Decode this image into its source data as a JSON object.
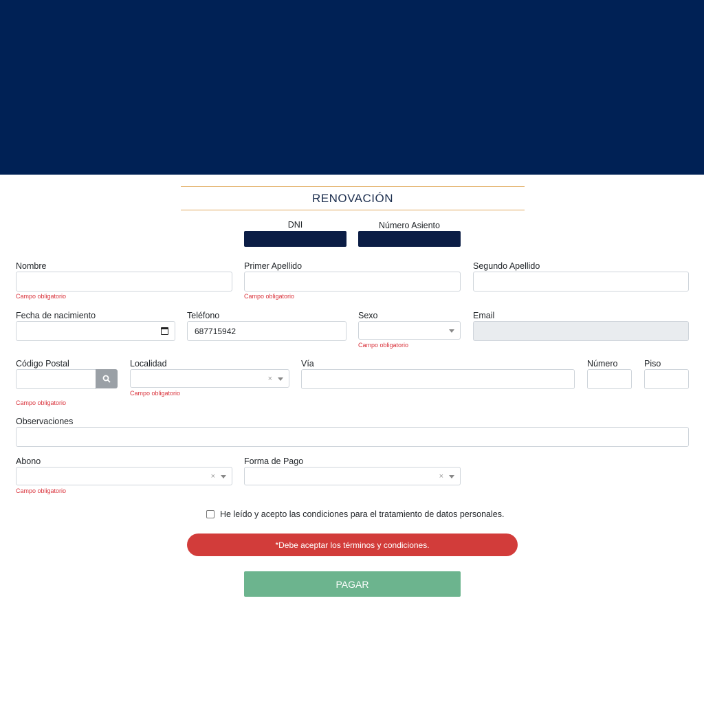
{
  "header": {
    "title": "RENOVACIÓN"
  },
  "ids": {
    "dni_label": "DNI",
    "seat_label": "Número Asiento"
  },
  "form": {
    "nombre": {
      "label": "Nombre",
      "error": "Campo obligatorio",
      "value": ""
    },
    "primer_apellido": {
      "label": "Primer Apellido",
      "error": "Campo obligatorio",
      "value": ""
    },
    "segundo_apellido": {
      "label": "Segundo Apellido",
      "value": ""
    },
    "fecha_nacimiento": {
      "label": "Fecha de nacimiento",
      "value": ""
    },
    "telefono": {
      "label": "Teléfono",
      "value": "687715942"
    },
    "sexo": {
      "label": "Sexo",
      "error": "Campo obligatorio",
      "value": ""
    },
    "email": {
      "label": "Email",
      "value": ""
    },
    "codigo_postal": {
      "label": "Código Postal",
      "error": "Campo obligatorio",
      "value": ""
    },
    "localidad": {
      "label": "Localidad",
      "error": "Campo obligatorio",
      "value": ""
    },
    "via": {
      "label": "Vía",
      "value": ""
    },
    "numero": {
      "label": "Número",
      "value": ""
    },
    "piso": {
      "label": "Piso",
      "value": ""
    },
    "observaciones": {
      "label": "Observaciones",
      "value": ""
    },
    "abono": {
      "label": "Abono",
      "error": "Campo obligatorio",
      "value": ""
    },
    "forma_pago": {
      "label": "Forma de Pago",
      "value": ""
    }
  },
  "terms": {
    "label": "He leído y acepto las condiciones para el tratamiento de datos personales.",
    "checked": false
  },
  "alert": {
    "text": "*Debe aceptar los términos y condiciones."
  },
  "actions": {
    "pay_label": "PAGAR"
  },
  "icons": {
    "search": "search-icon",
    "calendar": "calendar-icon",
    "clear": "clear-icon",
    "dropdown": "chevron-down-icon"
  },
  "colors": {
    "header_bg": "#002155",
    "error": "#d9313a",
    "alert_bg": "#d23c3a",
    "pay_button": "#6cb48e",
    "accent_line": "#e0a85a"
  }
}
